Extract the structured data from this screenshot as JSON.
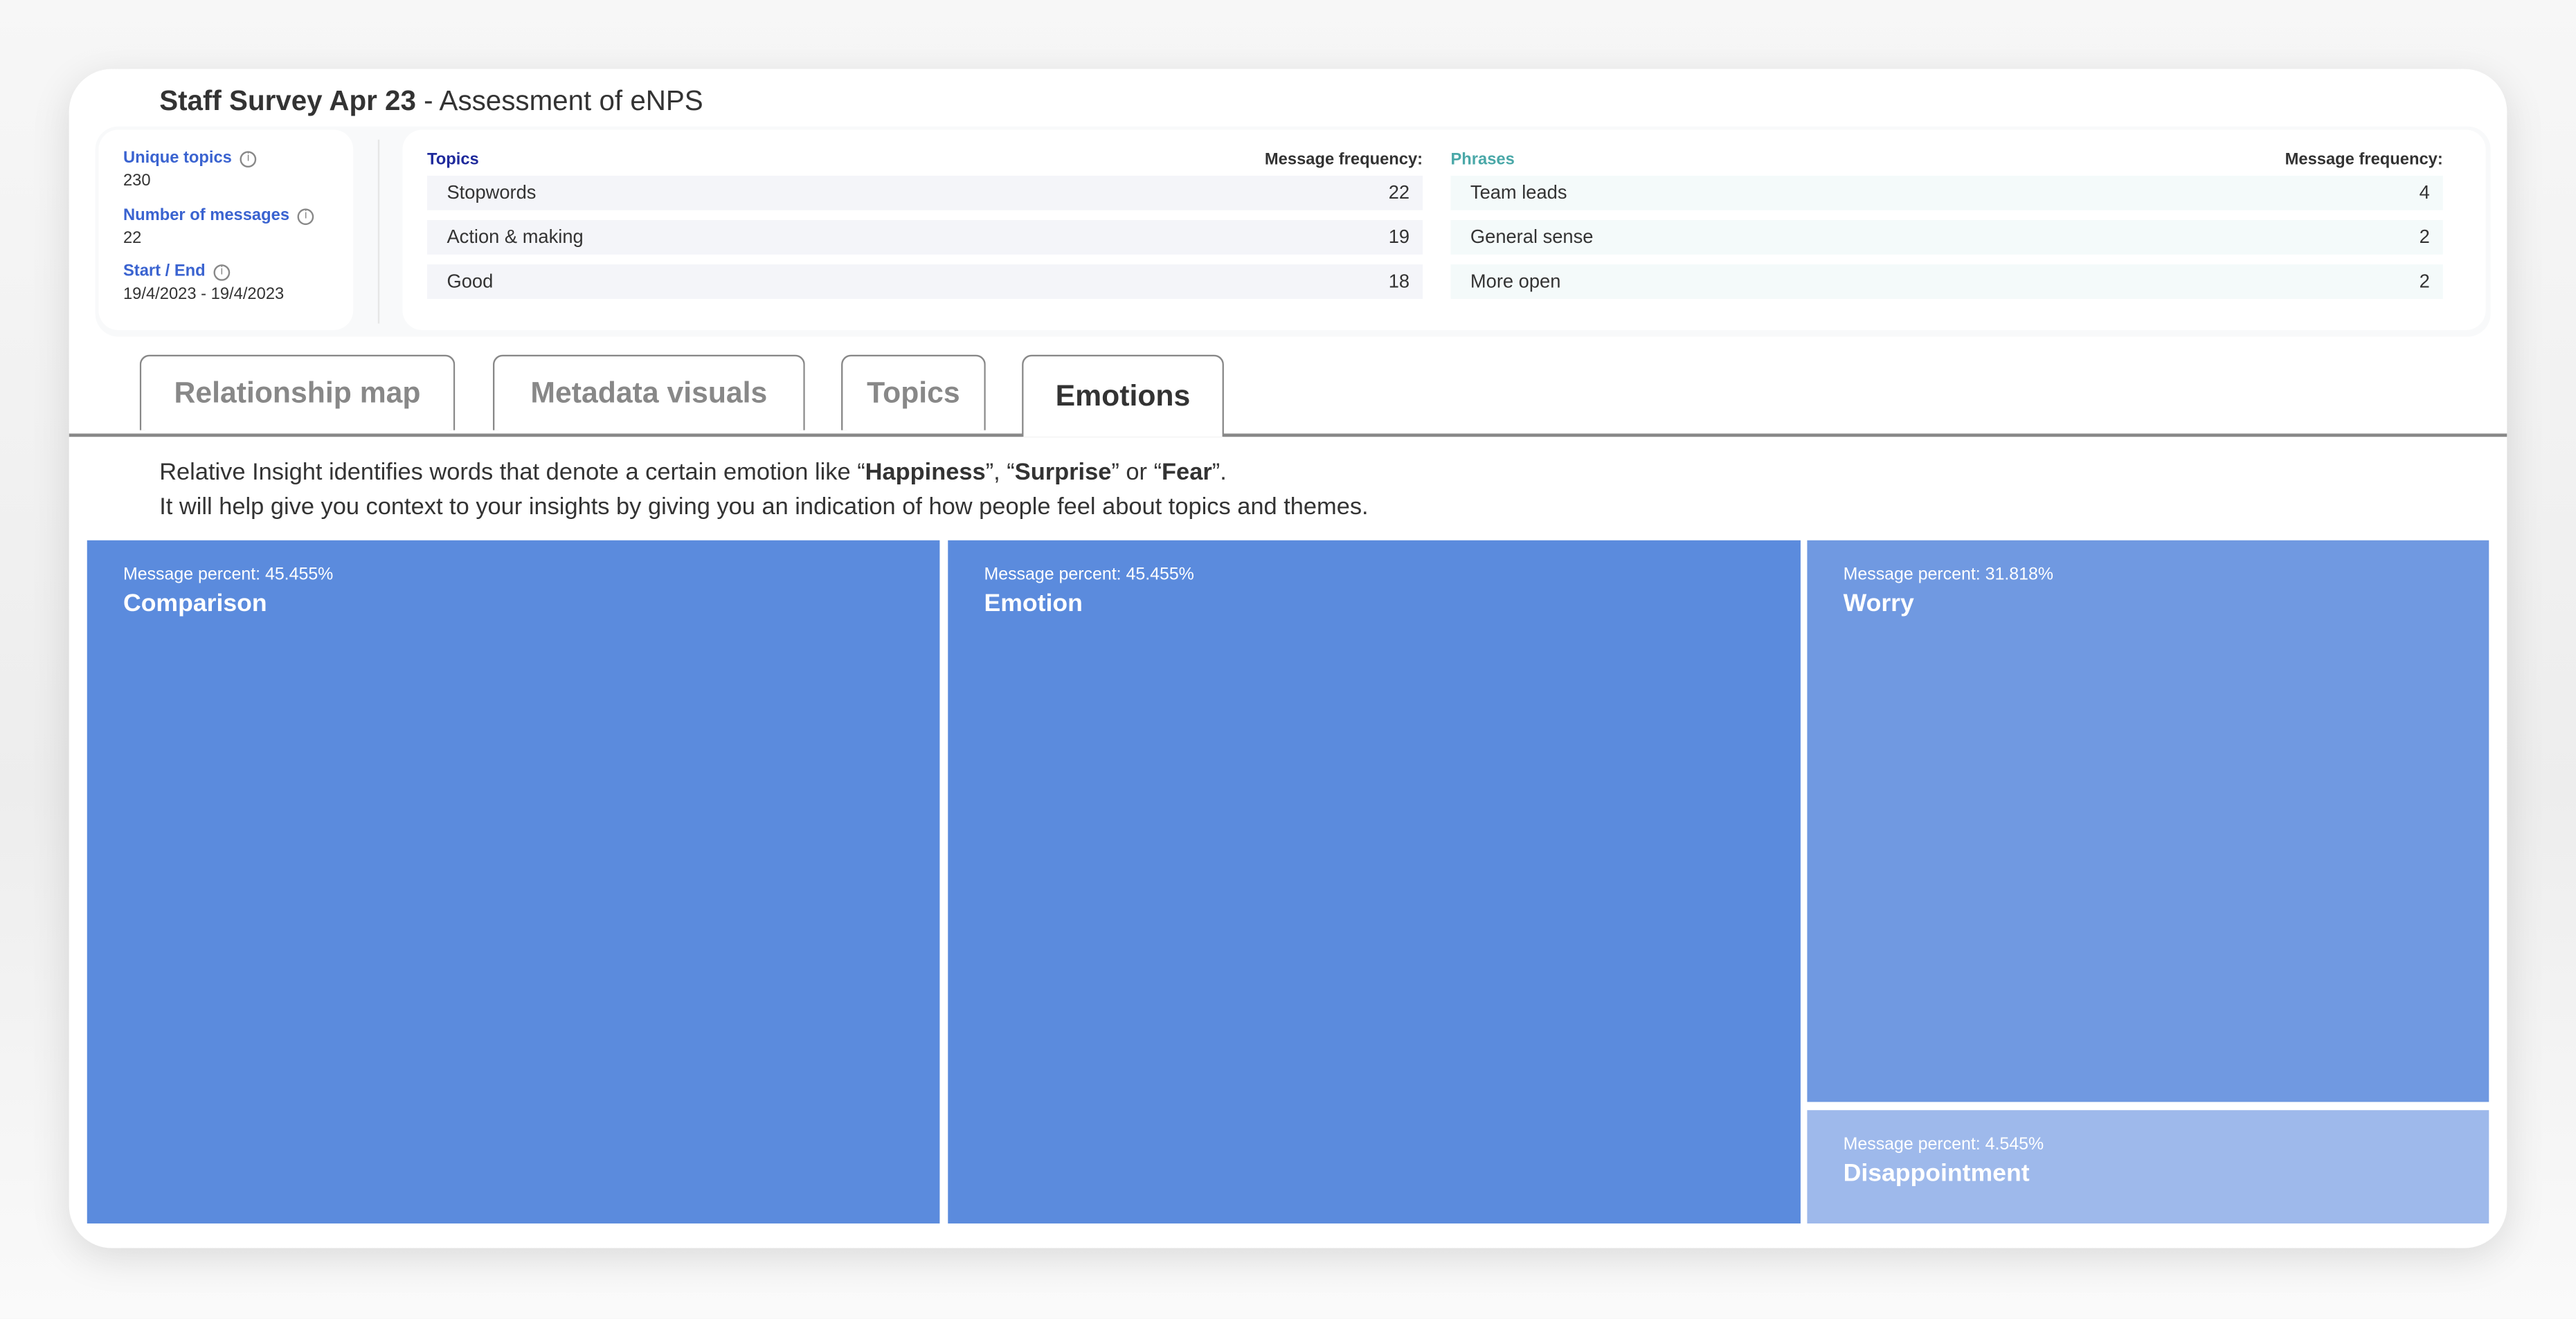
{
  "header": {
    "title_bold": "Staff Survey Apr 23",
    "title_rest": " - Assessment of eNPS"
  },
  "stats": [
    {
      "label": "Unique topics",
      "value": "230",
      "icon": "info-icon"
    },
    {
      "label": "Number of messages",
      "value": "22",
      "icon": "info-icon"
    },
    {
      "label": "Start / End",
      "value": "19/4/2023 - 19/4/2023",
      "icon": "info-icon"
    }
  ],
  "topics": {
    "header": "Topics",
    "freq_header": "Message frequency:",
    "color": "#1f2a9c",
    "row_bg": "#f4f5f9",
    "rows": [
      {
        "label": "Stopwords",
        "value": "22"
      },
      {
        "label": "Action & making",
        "value": "19"
      },
      {
        "label": "Good",
        "value": "18"
      }
    ]
  },
  "phrases": {
    "header": "Phrases",
    "freq_header": "Message frequency:",
    "color": "#4aa8a8",
    "row_bg": "#f4fafa",
    "rows": [
      {
        "label": "Team leads",
        "value": "4"
      },
      {
        "label": "General sense",
        "value": "2"
      },
      {
        "label": "More open",
        "value": "2"
      }
    ]
  },
  "tabs": [
    {
      "label": "Relationship map"
    },
    {
      "label": "Metadata visuals"
    },
    {
      "label": "Topics"
    },
    {
      "label": "Emotions",
      "active": true
    }
  ],
  "description": {
    "line1_a": "Relative Insight identifies words that denote a certain emotion like “",
    "b1": "Happiness",
    "line1_c": "”, “",
    "b2": "Surprise",
    "line1_e": "” or “",
    "b3": "Fear",
    "line1_g": "”.",
    "line2": "It will help give you context to your insights by giving you an indication of how people feel about topics and themes."
  },
  "chart_data": {
    "type": "treemap",
    "value_label": "Message percent",
    "items": [
      {
        "name": "Comparison",
        "value": 45.455,
        "label": "Message percent: 45.455%",
        "color": "#5b8bdd"
      },
      {
        "name": "Emotion",
        "value": 45.455,
        "label": "Message percent: 45.455%",
        "color": "#5b8bdd"
      },
      {
        "name": "Worry",
        "value": 31.818,
        "label": "Message percent: 31.818%",
        "color": "#7099e1"
      },
      {
        "name": "Disappointment",
        "value": 4.545,
        "label": "Message percent: 4.545%",
        "color": "#9eb9eb"
      }
    ]
  }
}
